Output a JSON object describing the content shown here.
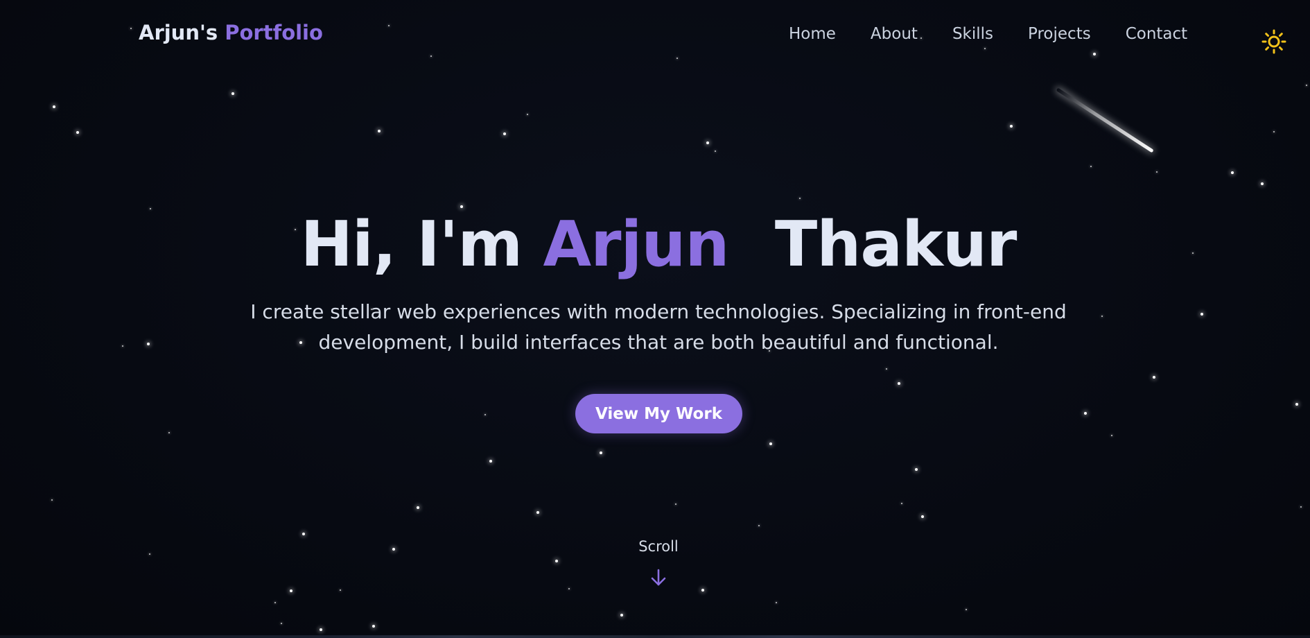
{
  "header": {
    "logo_main": "Arjun's",
    "logo_accent": "Portfolio",
    "nav": [
      {
        "label": "Home"
      },
      {
        "label": "About"
      },
      {
        "label": "Skills"
      },
      {
        "label": "Projects"
      },
      {
        "label": "Contact"
      }
    ],
    "theme_icon": "sun-icon"
  },
  "hero": {
    "title_prefix": "Hi, I'm",
    "title_accent": "Arjun",
    "title_suffix": "Thakur",
    "subtitle": "I create stellar web experiences with modern technologies. Specializing in front-end development, I build interfaces that are both beautiful and functional.",
    "cta_label": "View My Work"
  },
  "scroll": {
    "label": "Scroll",
    "icon": "arrow-down-icon"
  },
  "colors": {
    "background": "#070a12",
    "accent": "#8b6fe0",
    "text": "#e2e8f5",
    "sun": "#f2c21a"
  }
}
